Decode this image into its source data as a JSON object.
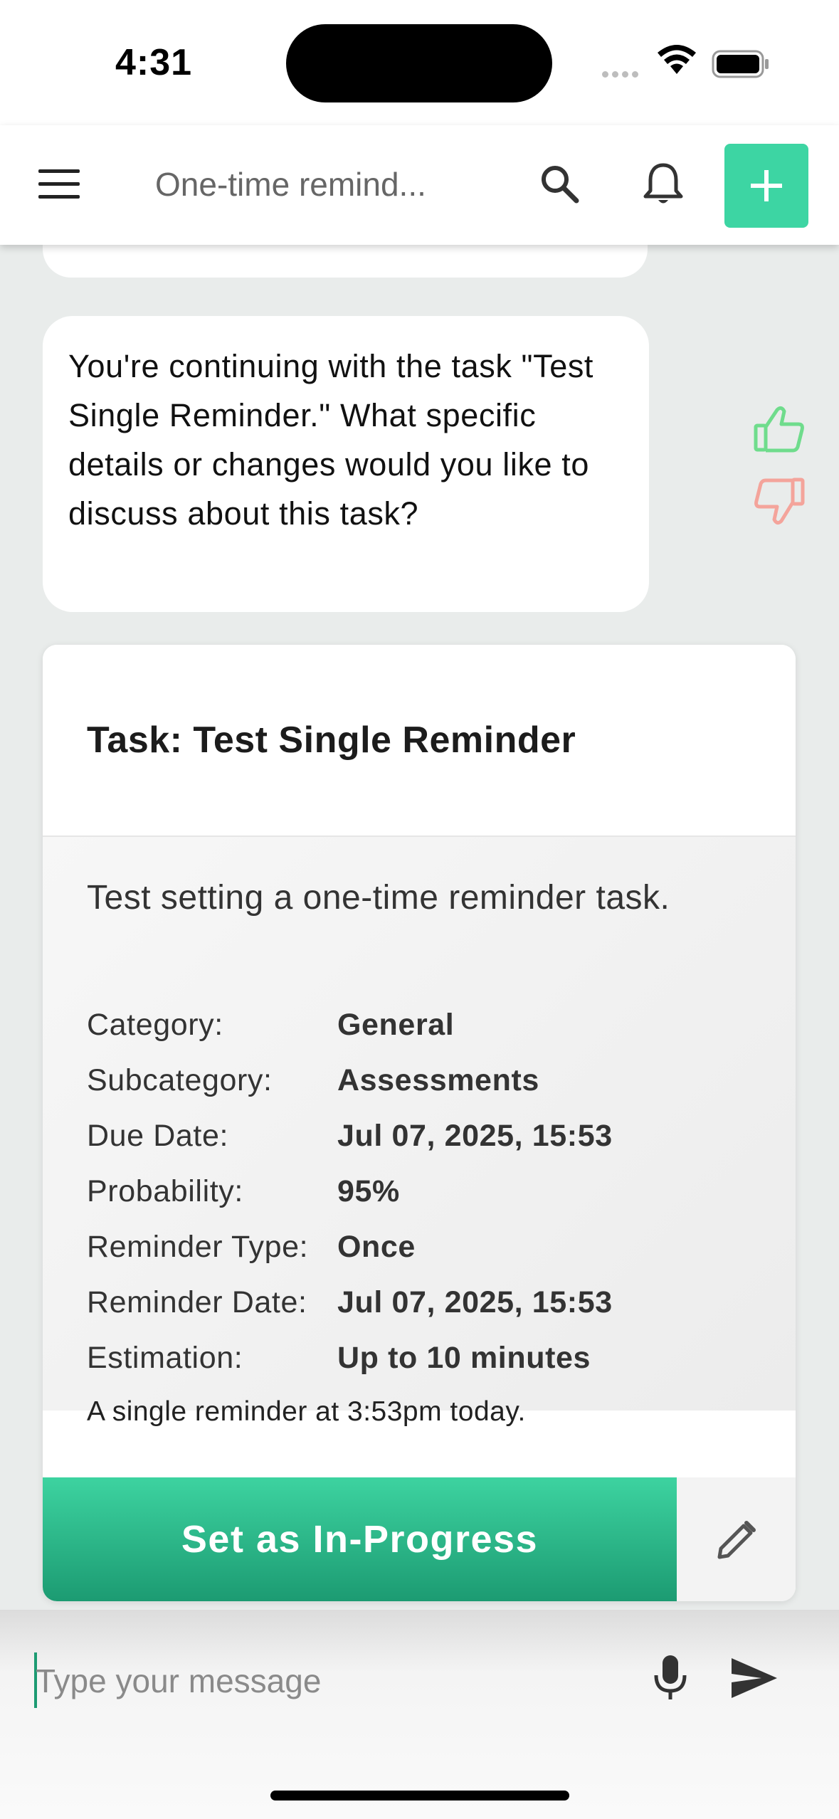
{
  "status_bar": {
    "time": "4:31"
  },
  "header": {
    "title": "One-time remind..."
  },
  "chat": {
    "bot_message": "You're continuing with the task \"Test Single Reminder.\" What specific details or changes would you like to discuss about this task?"
  },
  "task_card": {
    "title": "Task: Test Single Reminder",
    "description": "Test setting a one-time reminder task.",
    "details": [
      {
        "label": "Category:",
        "value": "General"
      },
      {
        "label": "Subcategory:",
        "value": "Assessments"
      },
      {
        "label": "Due Date:",
        "value": "Jul 07, 2025, 15:53"
      },
      {
        "label": "Probability:",
        "value": "95%"
      },
      {
        "label": "Reminder Type:",
        "value": "Once"
      },
      {
        "label": "Reminder Date:",
        "value": "Jul 07, 2025, 15:53"
      },
      {
        "label": "Estimation:",
        "value": "Up to 10 minutes"
      }
    ],
    "note": "A single reminder at 3:53pm today.",
    "primary_action": "Set as In-Progress"
  },
  "composer": {
    "placeholder": "Type your message"
  },
  "colors": {
    "accent": "#3dd5a3",
    "accent_dark": "#1c9b72",
    "like": "#6fdc8c",
    "dislike": "#f4a49b"
  },
  "icons": [
    "menu-icon",
    "search-icon",
    "bell-icon",
    "plus-icon",
    "thumb-up-icon",
    "thumb-down-icon",
    "pencil-icon",
    "microphone-icon",
    "send-icon",
    "wifi-icon",
    "battery-icon"
  ]
}
